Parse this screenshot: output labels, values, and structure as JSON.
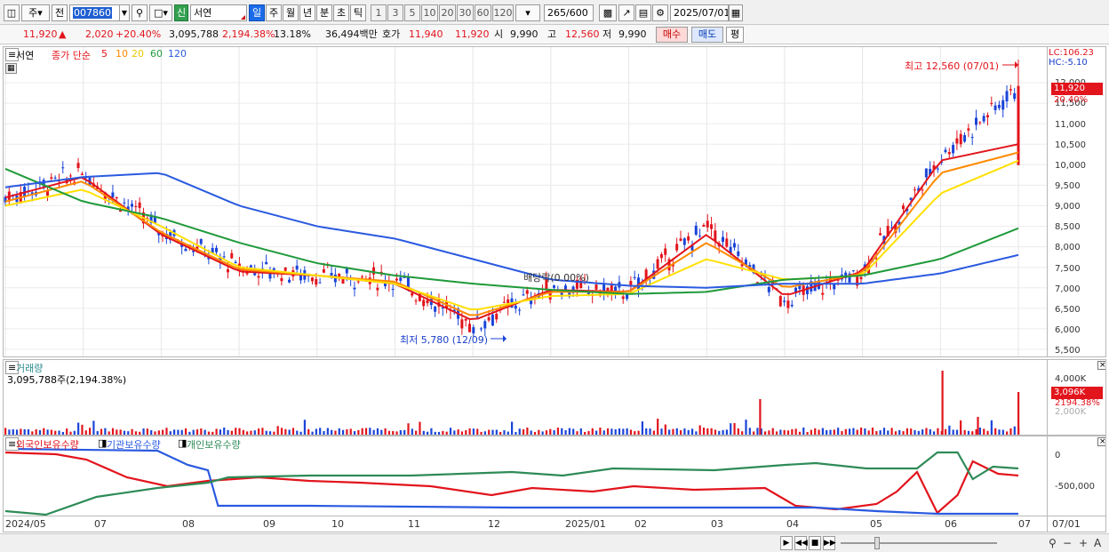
{
  "toolbar": {
    "mode_label": "주",
    "prev_label": "전",
    "stock_code": "007860",
    "market_badge": "신",
    "stock_name": "서연",
    "periods": [
      "일",
      "주",
      "월",
      "년",
      "분",
      "초",
      "틱"
    ],
    "active_period": "일",
    "intervals": [
      "1",
      "3",
      "5",
      "10",
      "20",
      "30",
      "60",
      "120"
    ],
    "count_value": "265",
    "count_max": "/600",
    "date_value": "2025/07/01"
  },
  "quote": {
    "price": "11,920",
    "change": "2,020",
    "change_pct": "+20.40%",
    "volume": "3,095,788",
    "volume_ratio": "2,194.38%",
    "turnover": "13.18%",
    "amount": "36,494백만",
    "bid_ask_label": "호가",
    "ask": "11,940",
    "bid": "11,920",
    "open_label": "시",
    "open": "9,990",
    "high_label": "고",
    "high": "12,560",
    "low_label": "저",
    "low": "9,990",
    "buy_label": "매수",
    "sell_label": "매도",
    "eval_label": "평"
  },
  "price_panel": {
    "name": "서연",
    "legend_prefix": "종가 단순",
    "ma_labels": [
      "5",
      "10",
      "20",
      "60",
      "120"
    ],
    "high_note": "최고 12,560 (07/01)",
    "low_note": "최저 5,780 (12/09)",
    "dividend_note": "배당락(0.00%)",
    "lc": "LC:106.23",
    "hc": "HC:-5.10",
    "current_price": "11,920",
    "current_pct": "20.40%",
    "yticks": [
      "12,000",
      "11,500",
      "11,000",
      "10,500",
      "10,000",
      "9,500",
      "9,000",
      "8,500",
      "8,000",
      "7,500",
      "7,000",
      "6,500",
      "6,000",
      "5,500"
    ]
  },
  "volume_panel": {
    "title": "거래량",
    "value": "3,095,788주(2,194.38%)",
    "ytick": "4,000K",
    "ytick2": "2,000K",
    "current": "3,096K",
    "current_pct": "2194.38%"
  },
  "holding_panel": {
    "labels": [
      "외국인보유수량",
      "기관보유수량",
      "개인보유수량"
    ],
    "yticks": [
      "0",
      "-500,000"
    ]
  },
  "xaxis": {
    "labels": [
      "2024/05",
      "07",
      "08",
      "09",
      "10",
      "11",
      "12",
      "2025/01",
      "02",
      "03",
      "04",
      "05",
      "06",
      "07"
    ],
    "right_label": "07/01"
  },
  "colors": {
    "up": "#e2141c",
    "down": "#1a44d8",
    "ma5": "#e2141c",
    "ma10": "#ff8a00",
    "ma20": "#ffe000",
    "ma60": "#1f9a3a",
    "ma120": "#2a5ae0",
    "foreign": "#e2141c",
    "institution": "#2a5ae0",
    "individual": "#2e8b57"
  },
  "chart_data": {
    "type": "line",
    "x": [
      "2024/05",
      "07",
      "08",
      "09",
      "10",
      "11",
      "12",
      "2025/01",
      "02",
      "03",
      "04",
      "05",
      "06",
      "07"
    ],
    "series": [
      {
        "name": "종가",
        "values": [
          9200,
          9800,
          8400,
          7500,
          7300,
          7200,
          6100,
          7000,
          6900,
          8500,
          6700,
          7400,
          10200,
          11920
        ]
      },
      {
        "name": "5",
        "values": [
          9200,
          9700,
          8300,
          7400,
          7300,
          7100,
          6200,
          6950,
          6900,
          8300,
          6800,
          7400,
          10100,
          10500
        ]
      },
      {
        "name": "10",
        "values": [
          9100,
          9600,
          8350,
          7450,
          7300,
          7150,
          6300,
          6900,
          6900,
          8100,
          7000,
          7350,
          9800,
          10300
        ]
      },
      {
        "name": "20",
        "values": [
          9000,
          9400,
          8500,
          7500,
          7300,
          7100,
          6450,
          6800,
          6850,
          7700,
          7200,
          7300,
          9300,
          10100
        ]
      },
      {
        "name": "60",
        "values": [
          9900,
          9100,
          8700,
          8100,
          7600,
          7300,
          7100,
          6950,
          6850,
          6900,
          7200,
          7300,
          7700,
          8450
        ]
      },
      {
        "name": "120",
        "values": [
          9450,
          9700,
          9800,
          9000,
          8500,
          8200,
          7700,
          7200,
          7050,
          7000,
          7100,
          7100,
          7350,
          7800
        ]
      }
    ],
    "ylim": [
      5500,
      12560
    ]
  }
}
